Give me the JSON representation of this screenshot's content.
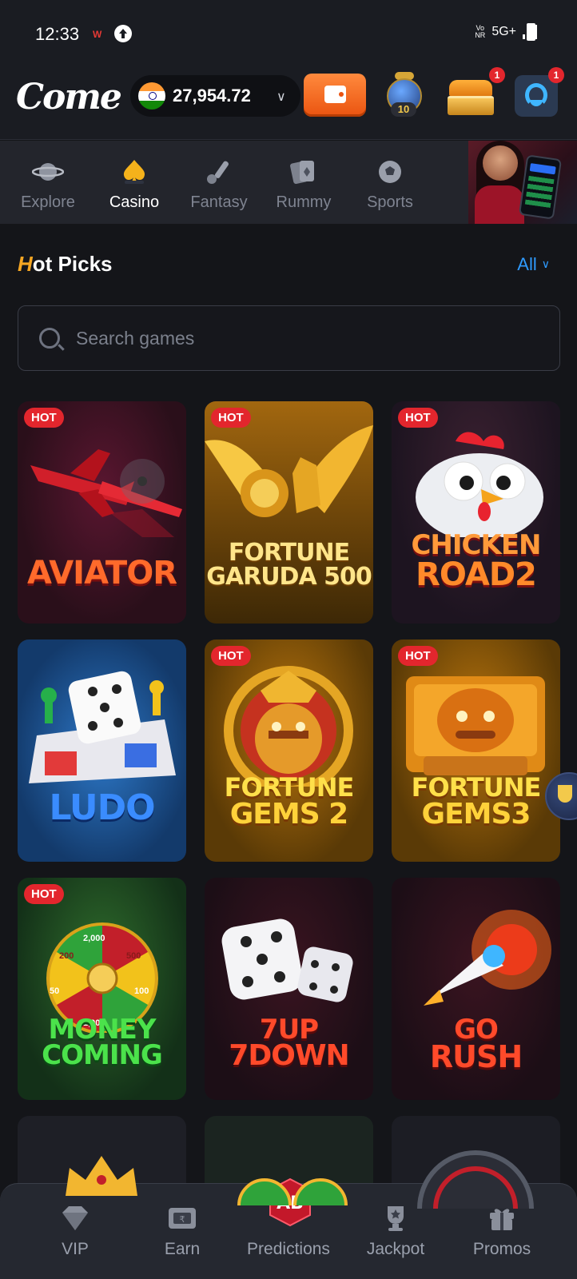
{
  "status_bar": {
    "time": "12:33",
    "carrier_icon": "W",
    "upload_icon": "upload-icon",
    "volte": "Vo\nNR",
    "network": "5G+"
  },
  "header": {
    "logo": "Come",
    "balance": "27,954.72",
    "currency_flag": "india-flag-icon",
    "jar_level": "10",
    "chest_badge": "1",
    "support_badge": "1"
  },
  "categories": [
    {
      "label": "Explore",
      "icon": "planet-icon",
      "active": false
    },
    {
      "label": "Casino",
      "icon": "spade-icon",
      "active": true
    },
    {
      "label": "Fantasy",
      "icon": "cricket-icon",
      "active": false
    },
    {
      "label": "Rummy",
      "icon": "cards-icon",
      "active": false
    },
    {
      "label": "Sports",
      "icon": "football-icon",
      "active": false
    }
  ],
  "section": {
    "title_first_letter": "H",
    "title_rest": "ot Picks",
    "all_label": "All"
  },
  "search": {
    "placeholder": "Search games"
  },
  "hot_label": "HOT",
  "games": [
    {
      "title": "AVIATOR",
      "hot": true
    },
    {
      "title": "FORTUNE GARUDA 500",
      "hot": true
    },
    {
      "title": "CHICKEN ROAD2",
      "hot": true
    },
    {
      "title": "LUDO",
      "hot": false
    },
    {
      "title": "FORTUNE GEMS 2",
      "hot": true
    },
    {
      "title": "FORTUNE GEMS3",
      "hot": true
    },
    {
      "title": "MONEY COMING",
      "hot": true
    },
    {
      "title": "7UP 7DOWN",
      "hot": false
    },
    {
      "title": "GO RUSH",
      "hot": false
    }
  ],
  "game_titles": {
    "aviator": "AVIATOR",
    "garuda_l1": "FORTUNE",
    "garuda_l2": "GARUDA 500",
    "chicken_l1": "CHICKEN",
    "chicken_l2": "ROAD2",
    "ludo": "LUDO",
    "gems2_l1": "FORTUNE",
    "gems2_l2": "GEMS 2",
    "gems3_l1": "FORTUNE",
    "gems3_l2": "GEMS3",
    "money_l1": "MONEY",
    "money_l2": "COMING",
    "updown_l1": "7UP",
    "updown_l2": "7DOWN",
    "rush_l1": "GO",
    "rush_l2": "RUSH"
  },
  "wheel_labels": [
    "2,000",
    "500",
    "200",
    "50",
    "100",
    "1,000"
  ],
  "bottom_nav": [
    {
      "label": "VIP",
      "icon": "diamond-icon"
    },
    {
      "label": "Earn",
      "icon": "earn-icon"
    },
    {
      "label": "Predictions",
      "icon": "ab-logo-icon"
    },
    {
      "label": "Jackpot",
      "icon": "trophy-icon"
    },
    {
      "label": "Promos",
      "icon": "gift-icon"
    }
  ],
  "colors": {
    "background": "#141519",
    "accent_orange": "#f5a623",
    "link_blue": "#2f9bff",
    "hot_red": "#e3262d"
  }
}
